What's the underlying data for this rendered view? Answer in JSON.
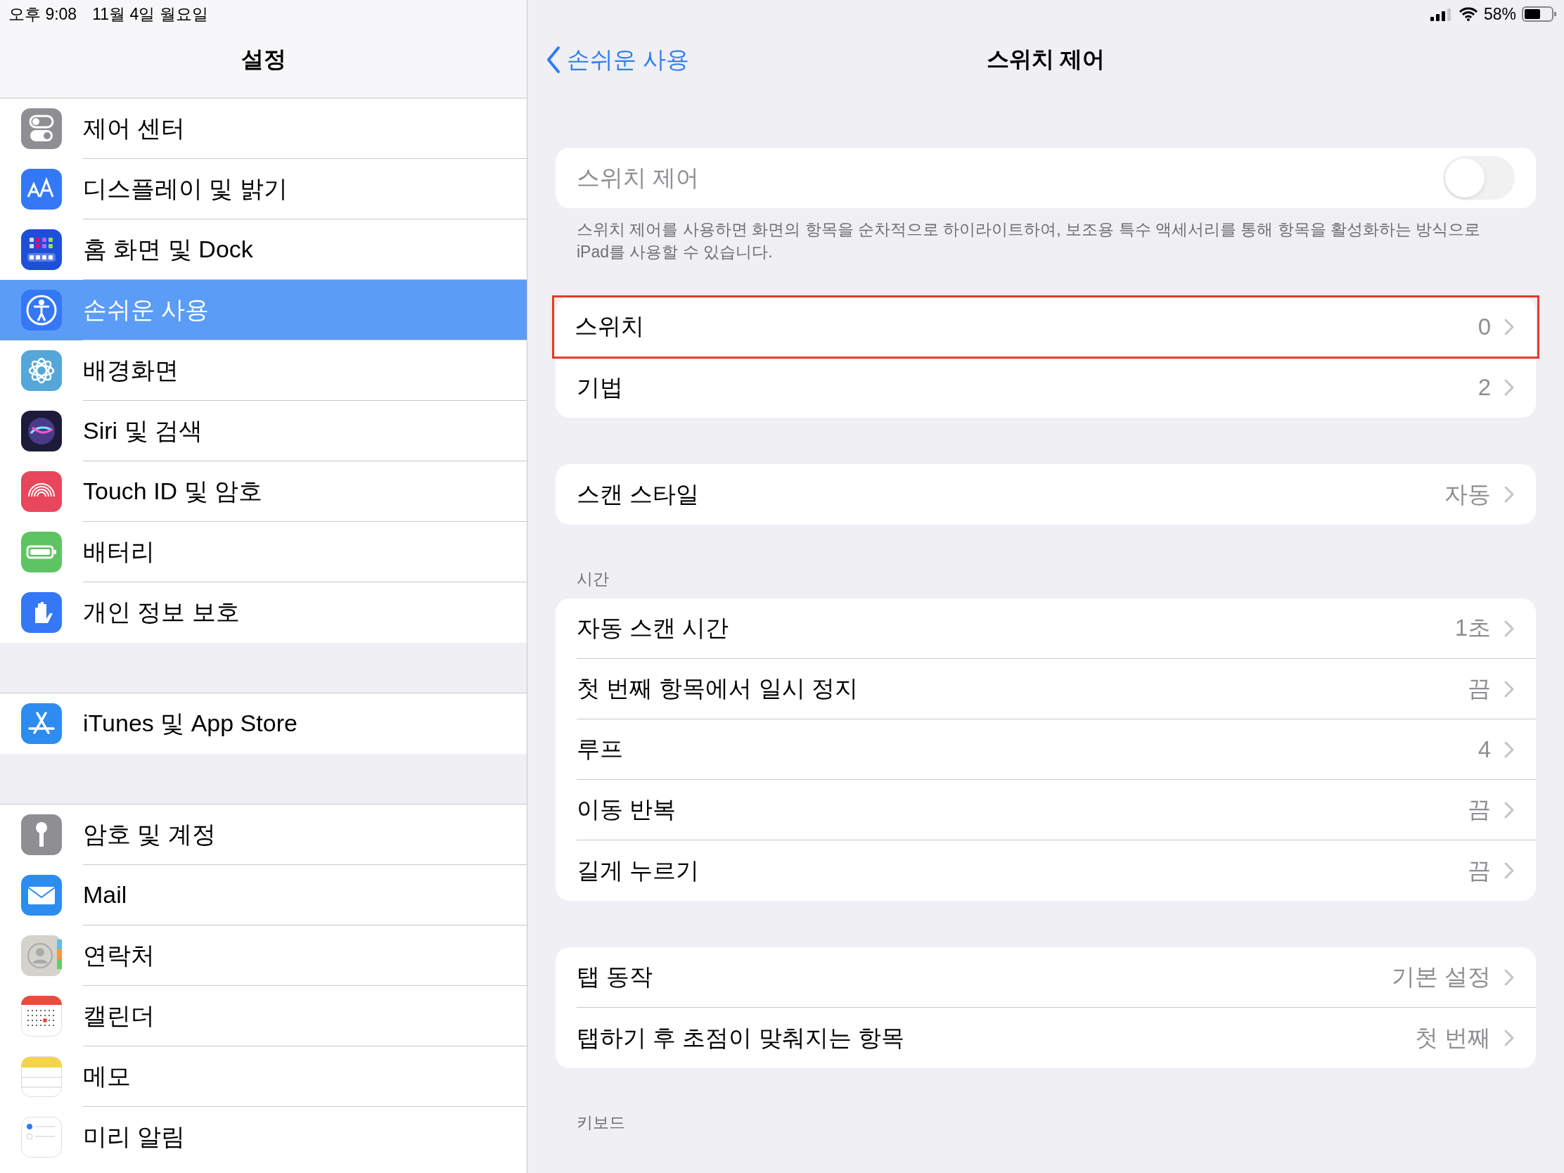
{
  "status_bar": {
    "time": "오후 9:08",
    "date": "11월 4일 월요일",
    "battery": "58%"
  },
  "sidebar": {
    "title": "설정",
    "groups": [
      [
        {
          "label": "제어 센터",
          "selected": false
        },
        {
          "label": "디스플레이 및 밝기",
          "selected": false
        },
        {
          "label": "홈 화면 및 Dock",
          "selected": false
        },
        {
          "label": "손쉬운 사용",
          "selected": true
        },
        {
          "label": "배경화면",
          "selected": false
        },
        {
          "label": "Siri 및 검색",
          "selected": false
        },
        {
          "label": "Touch ID 및 암호",
          "selected": false
        },
        {
          "label": "배터리",
          "selected": false
        },
        {
          "label": "개인 정보 보호",
          "selected": false
        }
      ],
      [
        {
          "label": "iTunes 및 App Store",
          "selected": false
        }
      ],
      [
        {
          "label": "암호 및 계정",
          "selected": false
        },
        {
          "label": "Mail",
          "selected": false
        },
        {
          "label": "연락처",
          "selected": false
        },
        {
          "label": "캘린더",
          "selected": false
        },
        {
          "label": "메모",
          "selected": false
        },
        {
          "label": "미리 알림",
          "selected": false
        }
      ]
    ]
  },
  "detail": {
    "back": "손쉬운 사용",
    "title": "스위치 제어",
    "toggle": {
      "label": "스위치 제어",
      "on": false,
      "disabled": true
    },
    "footer": "스위치 제어를 사용하면 화면의 항목을 순차적으로 하이라이트하여, 보조용 특수 액세서리를 통해 항목을 활성화하는 방식으로 iPad를 사용할 수 있습니다.",
    "sections": [
      {
        "rows": [
          {
            "label": "스위치",
            "value": "0",
            "highlighted": true
          },
          {
            "label": "기법",
            "value": "2",
            "highlighted": false
          }
        ]
      },
      {
        "rows": [
          {
            "label": "스캔 스타일",
            "value": "자동",
            "highlighted": false
          }
        ]
      },
      {
        "header": "시간",
        "rows": [
          {
            "label": "자동 스캔 시간",
            "value": "1초",
            "highlighted": false
          },
          {
            "label": "첫 번째 항목에서 일시 정지",
            "value": "끔",
            "highlighted": false
          },
          {
            "label": "루프",
            "value": "4",
            "highlighted": false
          },
          {
            "label": "이동 반복",
            "value": "끔",
            "highlighted": false
          },
          {
            "label": "길게 누르기",
            "value": "끔",
            "highlighted": false
          }
        ]
      },
      {
        "rows": [
          {
            "label": "탭 동작",
            "value": "기본 설정",
            "highlighted": false
          },
          {
            "label": "탭하기 후 초점이 맞춰지는 항목",
            "value": "첫 번째",
            "highlighted": false
          }
        ]
      },
      {
        "header": "키보드"
      }
    ]
  }
}
